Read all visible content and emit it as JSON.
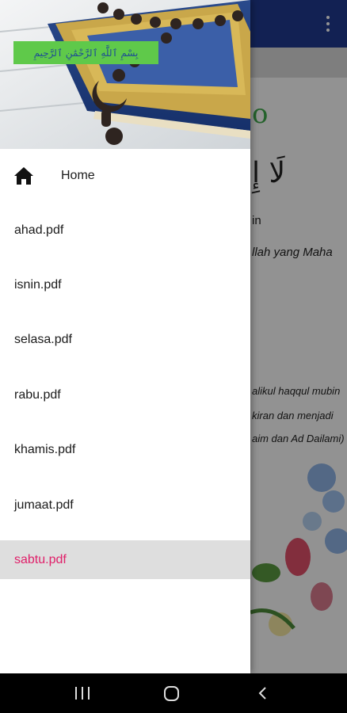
{
  "app": {
    "line_green": "o",
    "line_arabic": "لَا إِ",
    "line_small": "in",
    "line_italic1": "llah yang Maha",
    "line_italic2": "alikul haqqul mubin",
    "line_italic3": "kiran dan menjadi",
    "line_italic4": "aim dan Ad Dailami)"
  },
  "drawer": {
    "header_caption": "بِسْمِ ٱللَّٰهِ ٱلرَّحْمَٰنِ ٱلرَّحِيمِ",
    "home_label": "Home",
    "items": [
      {
        "label": "ahad.pdf"
      },
      {
        "label": "isnin.pdf"
      },
      {
        "label": "selasa.pdf"
      },
      {
        "label": "rabu.pdf"
      },
      {
        "label": "khamis.pdf"
      },
      {
        "label": "jumaat.pdf"
      },
      {
        "label": "sabtu.pdf"
      }
    ],
    "selected_index": 6
  },
  "colors": {
    "toolbar": "#1f3a8f",
    "selected_text": "#e0206a",
    "caption_bg": "#5fc94a"
  },
  "icons": {
    "home": "home-icon",
    "overflow": "overflow-menu-icon",
    "recents": "recents-icon",
    "system_home": "system-home-icon",
    "back": "back-icon"
  }
}
